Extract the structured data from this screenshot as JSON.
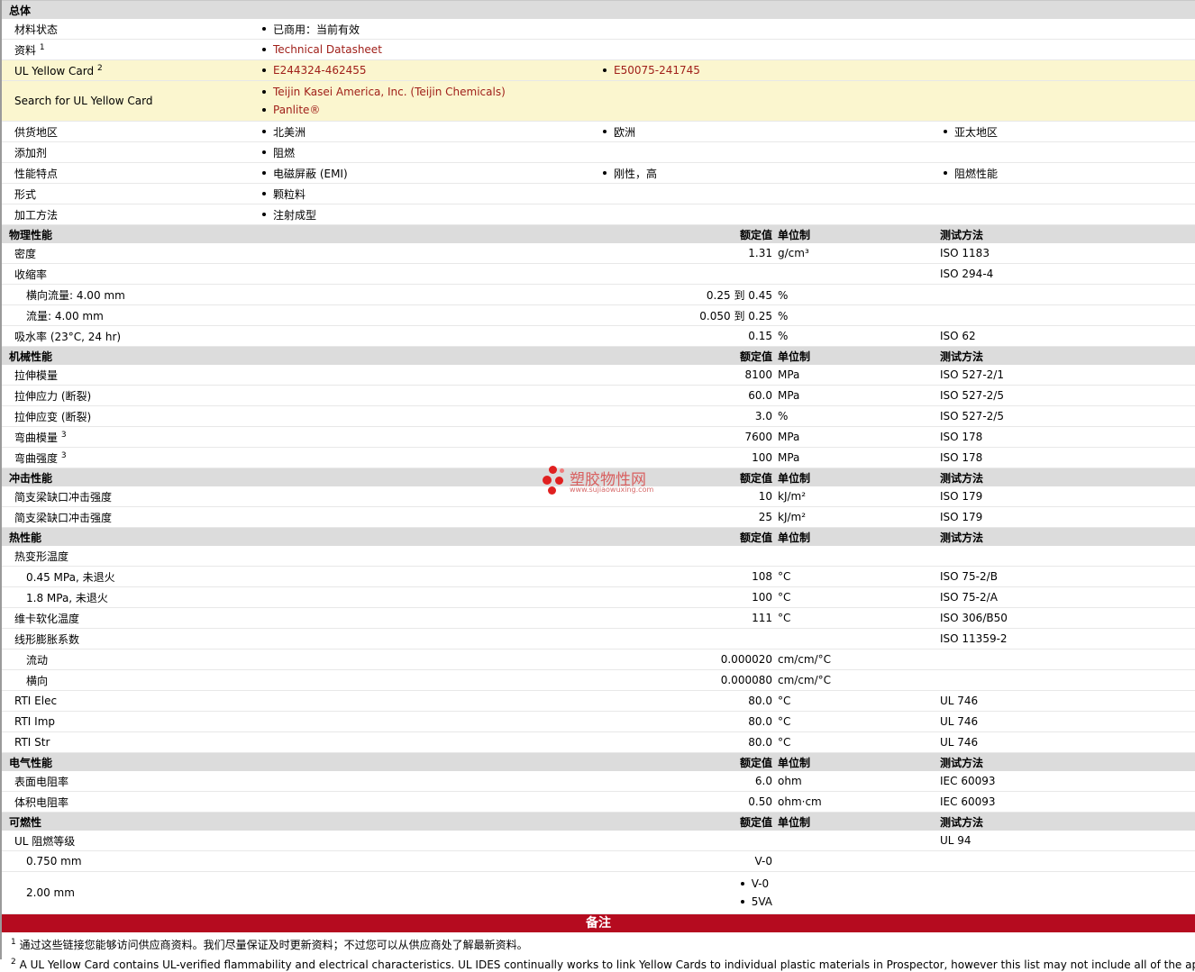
{
  "general": {
    "title": "总体",
    "rows": [
      {
        "label": "材料状态",
        "items": [
          "已商用：当前有效"
        ]
      },
      {
        "label": "资料",
        "sup": "1",
        "items": [
          "Technical Datasheet"
        ],
        "link": true
      },
      {
        "label": "UL Yellow Card",
        "sup": "2",
        "items": [
          "E244324-462455",
          "E50075-241745"
        ],
        "link": true,
        "yellow": true
      },
      {
        "label": "Search for UL Yellow Card",
        "items": [
          "Teijin Kasei America, Inc. (Teijin Chemicals)",
          "Panlite®"
        ],
        "link": true,
        "yellow": true,
        "stacked": true
      },
      {
        "label": "供货地区",
        "items": [
          "北美洲",
          "欧洲",
          "亚太地区"
        ]
      },
      {
        "label": "添加剂",
        "items": [
          "阻燃"
        ]
      },
      {
        "label": "性能特点",
        "items": [
          "电磁屏蔽 (EMI)",
          "刚性，高",
          "阻燃性能"
        ]
      },
      {
        "label": "形式",
        "items": [
          "颗粒料"
        ]
      },
      {
        "label": "加工方法",
        "items": [
          "注射成型"
        ]
      }
    ]
  },
  "col_headers": {
    "value": "额定值",
    "unit": "单位制",
    "test": "测试方法"
  },
  "sections": [
    {
      "title": "物理性能",
      "rows": [
        {
          "label": "密度",
          "value": "1.31",
          "unit": "g/cm³",
          "test": "ISO 1183"
        },
        {
          "label": "收缩率",
          "value": "",
          "unit": "",
          "test": "ISO 294-4"
        },
        {
          "label": "横向流量: 4.00 mm",
          "indent": true,
          "value": "0.25 到  0.45",
          "unit": "%",
          "test": ""
        },
        {
          "label": "流量: 4.00 mm",
          "indent": true,
          "value": "0.050 到  0.25",
          "unit": "%",
          "test": ""
        },
        {
          "label": "吸水率 (23°C, 24 hr)",
          "value": "0.15",
          "unit": "%",
          "test": "ISO 62"
        }
      ]
    },
    {
      "title": "机械性能",
      "rows": [
        {
          "label": "拉伸模量",
          "value": "8100",
          "unit": "MPa",
          "test": "ISO 527-2/1"
        },
        {
          "label": "拉伸应力 (断裂)",
          "value": "60.0",
          "unit": "MPa",
          "test": "ISO 527-2/5"
        },
        {
          "label": "拉伸应变 (断裂)",
          "value": "3.0",
          "unit": "%",
          "test": "ISO 527-2/5"
        },
        {
          "label": "弯曲模量",
          "sup": "3",
          "value": "7600",
          "unit": "MPa",
          "test": "ISO 178"
        },
        {
          "label": "弯曲强度",
          "sup": "3",
          "value": "100",
          "unit": "MPa",
          "test": "ISO 178"
        }
      ]
    },
    {
      "title": "冲击性能",
      "rows": [
        {
          "label": "简支梁缺口冲击强度",
          "value": "10",
          "unit": "kJ/m²",
          "test": "ISO 179"
        },
        {
          "label": "简支梁缺口冲击强度",
          "value": "25",
          "unit": "kJ/m²",
          "test": "ISO 179"
        }
      ]
    },
    {
      "title": "热性能",
      "rows": [
        {
          "label": "热变形温度",
          "value": "",
          "unit": "",
          "test": ""
        },
        {
          "label": "0.45 MPa, 未退火",
          "indent": true,
          "value": "108",
          "unit": "°C",
          "test": "ISO 75-2/B"
        },
        {
          "label": "1.8 MPa, 未退火",
          "indent": true,
          "value": "100",
          "unit": "°C",
          "test": "ISO 75-2/A"
        },
        {
          "label": "维卡软化温度",
          "value": "111",
          "unit": "°C",
          "test": "ISO 306/B50"
        },
        {
          "label": "线形膨胀系数",
          "value": "",
          "unit": "",
          "test": "ISO 11359-2"
        },
        {
          "label": "流动",
          "indent": true,
          "value": "0.000020",
          "unit": "cm/cm/°C",
          "test": ""
        },
        {
          "label": "横向",
          "indent": true,
          "value": "0.000080",
          "unit": "cm/cm/°C",
          "test": ""
        },
        {
          "label": "RTI Elec",
          "value": "80.0",
          "unit": "°C",
          "test": "UL 746"
        },
        {
          "label": "RTI Imp",
          "value": "80.0",
          "unit": "°C",
          "test": "UL 746"
        },
        {
          "label": "RTI Str",
          "value": "80.0",
          "unit": "°C",
          "test": "UL 746"
        }
      ]
    },
    {
      "title": "电气性能",
      "rows": [
        {
          "label": "表面电阻率",
          "value": "6.0",
          "unit": "ohm",
          "test": "IEC 60093"
        },
        {
          "label": "体积电阻率",
          "value": "0.50",
          "unit": "ohm·cm",
          "test": "IEC 60093"
        }
      ]
    },
    {
      "title": "可燃性",
      "rows": [
        {
          "label": "UL 阻燃等级",
          "value": "",
          "unit": "",
          "test": "UL 94"
        },
        {
          "label": "0.750 mm",
          "indent": true,
          "value": "V-0",
          "unit": "",
          "test": ""
        },
        {
          "label": "2.00 mm",
          "indent": true,
          "values": [
            "V-0",
            "5VA"
          ],
          "unit": "",
          "test": ""
        }
      ]
    }
  ],
  "notes": {
    "title": "备注",
    "footnotes": [
      {
        "num": "1",
        "text": "通过这些链接您能够访问供应商资料。我们尽量保证及时更新资料；不过您可以从供应商处了解最新资料。"
      },
      {
        "num": "2",
        "text": "A UL Yellow Card contains UL-verified flammability and electrical characteristics. UL IDES continually works to link Yellow Cards to individual plastic materials in Prospector, however this list may not include all of the appropriate"
      }
    ]
  },
  "watermark": {
    "name": "塑胶物性网",
    "url": "www.sujiaowuxing.com"
  }
}
